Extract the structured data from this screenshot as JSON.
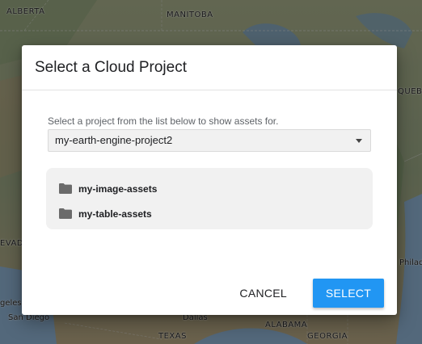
{
  "map": {
    "labels": {
      "alberta": "ALBERTA",
      "manitoba": "MANITOBA",
      "quebec": "QUEBEC",
      "nevada": "EVADA",
      "philadelphia": "Philad",
      "los_angeles": "geles",
      "san_diego": "San Diego",
      "dallas": "Dallas",
      "texas": "TEXAS",
      "alabama": "ALABAMA",
      "georgia": "GEORGIA"
    }
  },
  "dialog": {
    "title": "Select a Cloud Project",
    "hint": "Select a project from the list below to show assets for.",
    "project_select": {
      "selected": "my-earth-engine-project2"
    },
    "assets": [
      {
        "label": "my-image-assets",
        "icon": "folder-icon"
      },
      {
        "label": "my-table-assets",
        "icon": "folder-icon"
      }
    ],
    "actions": {
      "cancel_label": "CANCEL",
      "select_label": "SELECT"
    }
  },
  "colors": {
    "primary": "#2196f3",
    "scrim": "rgba(0,0,0,0.42)"
  }
}
